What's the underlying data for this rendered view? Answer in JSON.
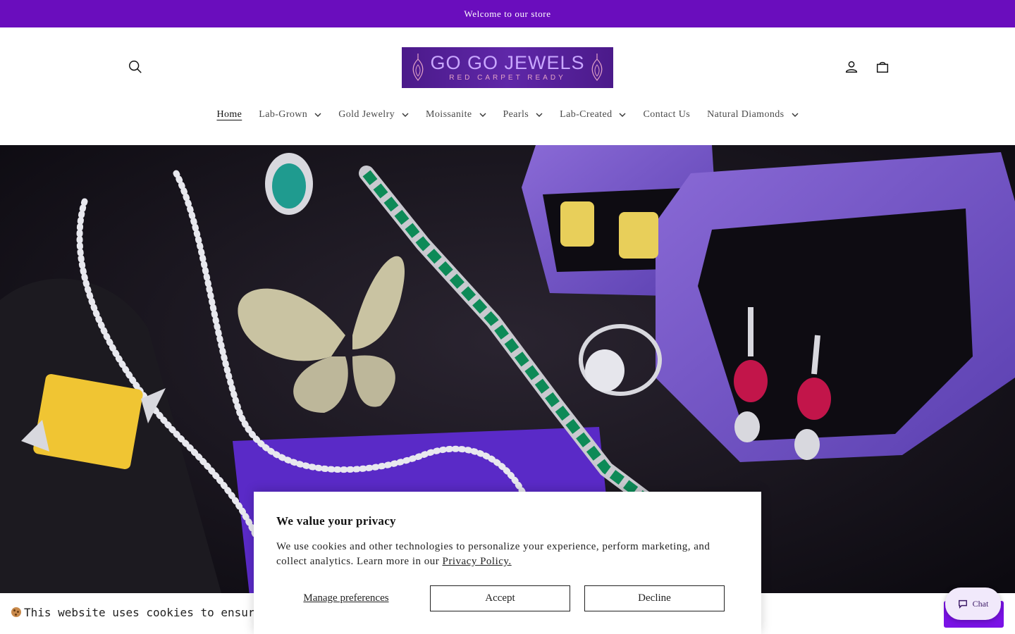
{
  "announcement": {
    "text": "Welcome to our store"
  },
  "header": {
    "logo": {
      "title": "GO GO JEWELS",
      "tagline": "RED CARPET READY"
    },
    "search_icon": "search-icon",
    "account_icon": "user-icon",
    "cart_icon": "cart-icon"
  },
  "nav": {
    "items": [
      {
        "label": "Home",
        "active": true,
        "dropdown": false
      },
      {
        "label": "Lab-Grown",
        "dropdown": true
      },
      {
        "label": "Gold Jewelry",
        "dropdown": true
      },
      {
        "label": "Moissanite",
        "dropdown": true
      },
      {
        "label": "Pearls",
        "dropdown": true
      },
      {
        "label": "Lab-Created",
        "dropdown": true
      },
      {
        "label": "Contact Us",
        "dropdown": false
      },
      {
        "label": "Natural Diamonds",
        "dropdown": true
      }
    ]
  },
  "privacy": {
    "title": "We value your privacy",
    "text": "We use cookies and other technologies to personalize your experience, perform marketing, and collect analytics. Learn more in our ",
    "link": "Privacy Policy.",
    "manage_label": "Manage preferences",
    "accept_label": "Accept",
    "decline_label": "Decline"
  },
  "cookie_bar": {
    "text": "This website uses cookies to ensure you g"
  },
  "chat": {
    "label": "Chat"
  },
  "colors": {
    "accent": "#6a0dbd",
    "button": "#7a12e6"
  }
}
